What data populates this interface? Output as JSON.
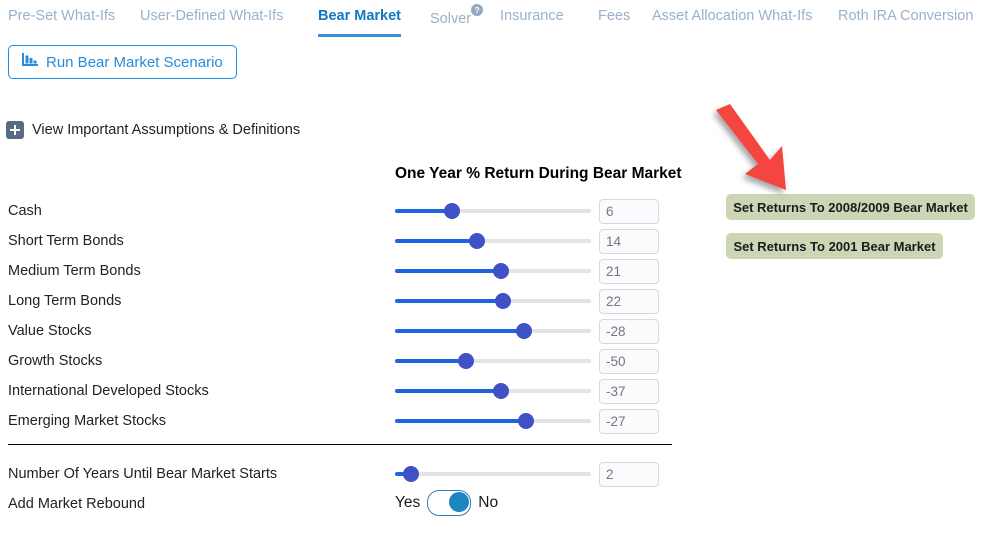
{
  "tabs": [
    {
      "label": "Pre-Set What-Ifs",
      "active": false,
      "help": false
    },
    {
      "label": "User-Defined What-Ifs",
      "active": false,
      "help": false
    },
    {
      "label": "Bear Market",
      "active": true,
      "help": false
    },
    {
      "label": "Solver",
      "active": false,
      "help": true,
      "help_glyph": "?"
    },
    {
      "label": "Insurance",
      "active": false,
      "help": false
    },
    {
      "label": "Fees",
      "active": false,
      "help": false
    },
    {
      "label": "Asset Allocation What-Ifs",
      "active": false,
      "help": false
    },
    {
      "label": "Roth IRA Conversion",
      "active": false,
      "help": false
    }
  ],
  "toolbar": {
    "run_button_label": "Run Bear Market Scenario",
    "run_button_icon": "bar-chart-declining-icon"
  },
  "expander": {
    "label": "View Important Assumptions & Definitions",
    "icon": "plus-icon"
  },
  "section": {
    "title": "One Year % Return During Bear Market"
  },
  "asset_rows": [
    {
      "label": "Cash",
      "value": "6",
      "thumb_pct": 29
    },
    {
      "label": "Short Term Bonds",
      "value": "14",
      "thumb_pct": 42
    },
    {
      "label": "Medium Term Bonds",
      "value": "21",
      "thumb_pct": 54
    },
    {
      "label": "Long Term Bonds",
      "value": "22",
      "thumb_pct": 55
    },
    {
      "label": "Value Stocks",
      "value": "-28",
      "thumb_pct": 66
    },
    {
      "label": "Growth Stocks",
      "value": "-50",
      "thumb_pct": 36
    },
    {
      "label": "International Developed Stocks",
      "value": "-37",
      "thumb_pct": 54
    },
    {
      "label": "Emerging Market Stocks",
      "value": "-27",
      "thumb_pct": 67
    }
  ],
  "bottom": {
    "years_label": "Number Of Years Until Bear Market Starts",
    "years_value": "2",
    "years_thumb_pct": 8,
    "rebound_label": "Add Market Rebound",
    "toggle_yes": "Yes",
    "toggle_no": "No",
    "toggle_state": "No"
  },
  "presets": {
    "preset_2008_label": "Set Returns To 2008/2009 Bear Market",
    "preset_2001_label": "Set Returns To 2001 Bear Market"
  },
  "annotation": {
    "arrow": "red-arrow-pointing-down-right",
    "color": "#f5453f"
  },
  "colors": {
    "active_tab": "#1279c0",
    "inactive_tab": "#9bb0c9",
    "slider_fill": "#1f63e0",
    "slider_thumb": "#3f51c4",
    "preset_button": "#ccd5b4",
    "toggle_knob": "#1b86bf",
    "arrow_red": "#f5453f"
  }
}
